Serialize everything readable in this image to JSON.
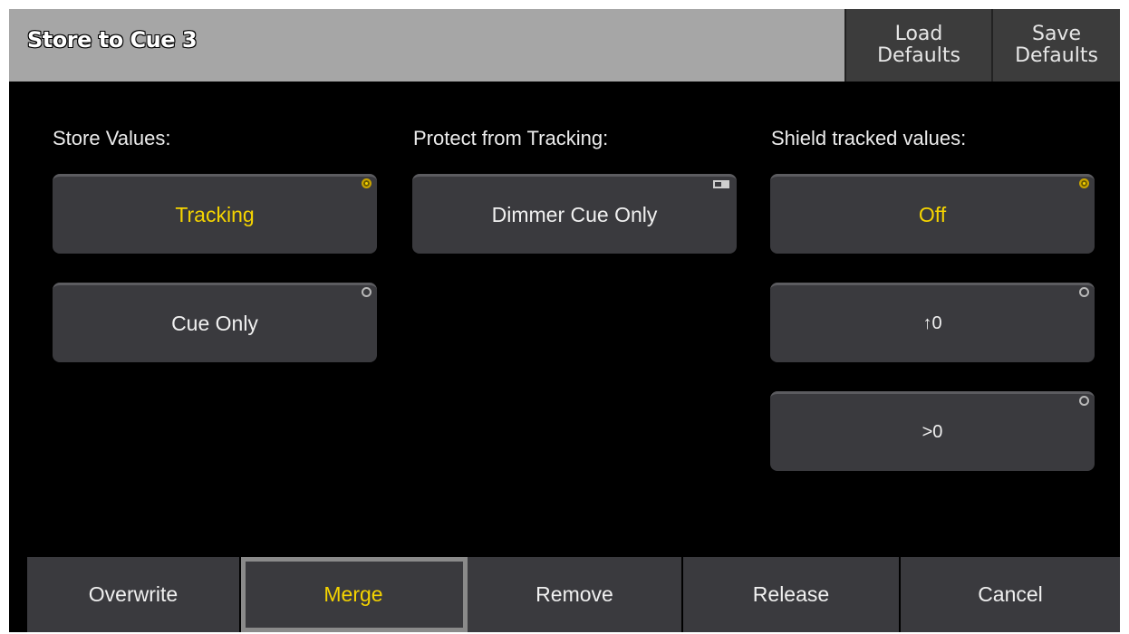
{
  "window": {
    "title": "Store to Cue 3",
    "header_buttons": [
      {
        "label": "Load\nDefaults"
      },
      {
        "label": "Save\nDefaults"
      }
    ]
  },
  "columns": [
    {
      "label": "Store Values:",
      "options": [
        {
          "label": "Tracking",
          "selected": true
        },
        {
          "label": "Cue Only",
          "selected": false
        }
      ]
    },
    {
      "label": "Protect from Tracking:",
      "options": [
        {
          "label": "Dimmer Cue Only",
          "selected": false
        }
      ]
    },
    {
      "label": "Shield tracked values:",
      "options": [
        {
          "label": "Off",
          "selected": true
        },
        {
          "label": "↑0",
          "selected": false
        },
        {
          "label": ">0",
          "selected": false
        }
      ]
    }
  ],
  "footer": {
    "buttons": [
      {
        "label": "Overwrite",
        "selected": false
      },
      {
        "label": "Merge",
        "selected": true
      },
      {
        "label": "Remove",
        "selected": false
      },
      {
        "label": "Release",
        "selected": false
      },
      {
        "label": "Cancel",
        "selected": false
      }
    ]
  },
  "colors": {
    "background": "#000000",
    "titlebar": "#a6a6a6",
    "button": "#3a3a3e",
    "selected_text": "#f5d400",
    "text": "#f0f0f0"
  }
}
